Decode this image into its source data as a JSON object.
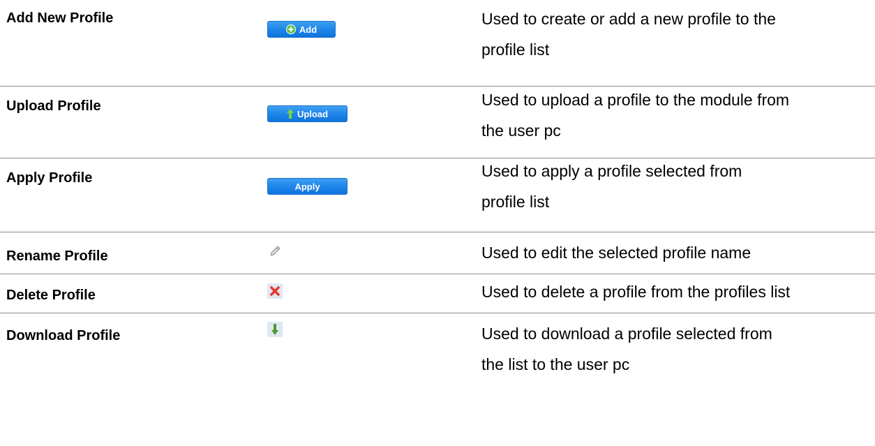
{
  "rows": [
    {
      "feature": "Add New Profile",
      "control": {
        "type": "button",
        "label": "Add",
        "icon": "plus-circle-icon"
      },
      "description": [
        "Used to create or add a new profile to the",
        "profile list"
      ]
    },
    {
      "feature": "Upload Profile",
      "control": {
        "type": "button",
        "label": "Upload",
        "icon": "arrow-up-icon"
      },
      "description": [
        "Used to upload a profile to the module from",
        "the user pc"
      ]
    },
    {
      "feature": "Apply Profile",
      "control": {
        "type": "button",
        "label": "Apply",
        "icon": ""
      },
      "description": [
        "Used to apply a profile selected from",
        "profile list"
      ]
    },
    {
      "feature": "Rename Profile",
      "control": {
        "type": "icon",
        "label": "",
        "icon": "pencil-icon"
      },
      "description": [
        "Used to edit the selected profile name"
      ]
    },
    {
      "feature": "Delete Profile",
      "control": {
        "type": "icon",
        "label": "",
        "icon": "red-x-icon"
      },
      "description": [
        "Used to delete a profile from the profiles list"
      ]
    },
    {
      "feature": "Download Profile",
      "control": {
        "type": "icon",
        "label": "",
        "icon": "arrow-down-icon"
      },
      "description": [
        "Used to download a profile selected from",
        "the list to the user pc"
      ]
    }
  ],
  "colors": {
    "button_blue": "#1f86ea",
    "divider": "#8a8a8a",
    "delete_red": "#e8342a",
    "arrow_green": "#4a9a2a"
  }
}
